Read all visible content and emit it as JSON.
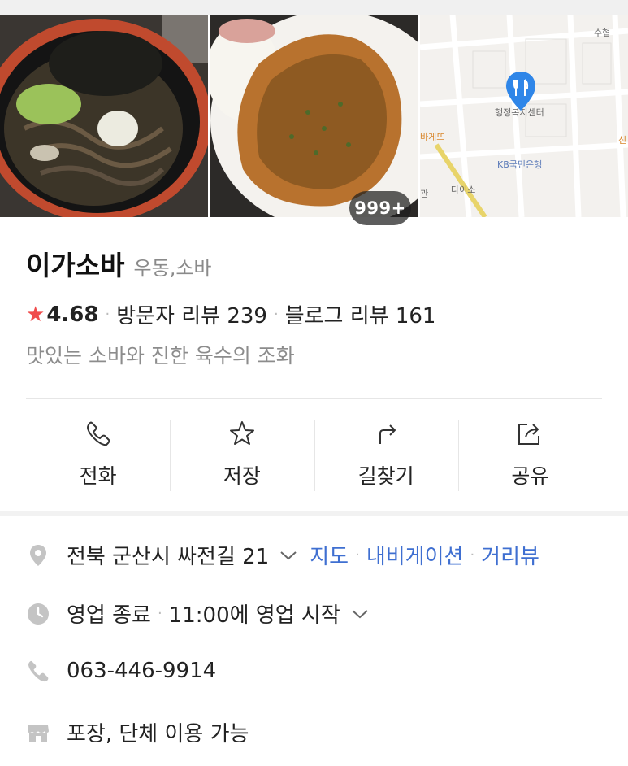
{
  "gallery": {
    "photo_count_badge": "999+",
    "map_labels": {
      "subway": "수협",
      "center": "행정복지센터",
      "shop_left": "바게뜨",
      "bank": "KB국민은행",
      "daiso": "다이소",
      "edge_left": "관",
      "edge_right": "신"
    }
  },
  "place": {
    "name": "이가소바",
    "category": "우동,소바",
    "rating": "4.68",
    "visitor_reviews": "방문자 리뷰 239",
    "blog_reviews": "블로그 리뷰 161",
    "description": "맛있는 소바와 진한 육수의 조화"
  },
  "actions": [
    {
      "label": "전화",
      "icon": "phone-icon"
    },
    {
      "label": "저장",
      "icon": "star-icon"
    },
    {
      "label": "길찾기",
      "icon": "directions-icon"
    },
    {
      "label": "공유",
      "icon": "share-icon"
    }
  ],
  "info": {
    "address": "전북 군산시 싸전길 21",
    "map_link": "지도",
    "navigation_link": "내비게이션",
    "streetview_link": "거리뷰",
    "hours_status": "영업 종료",
    "hours_next": "11:00에 영업 시작",
    "phone": "063-446-9914",
    "services": "포장, 단체 이용 가능"
  },
  "colors": {
    "accent_link": "#3f6fd1",
    "rating_star": "#f04b4b",
    "map_pin": "#2f86e8"
  }
}
